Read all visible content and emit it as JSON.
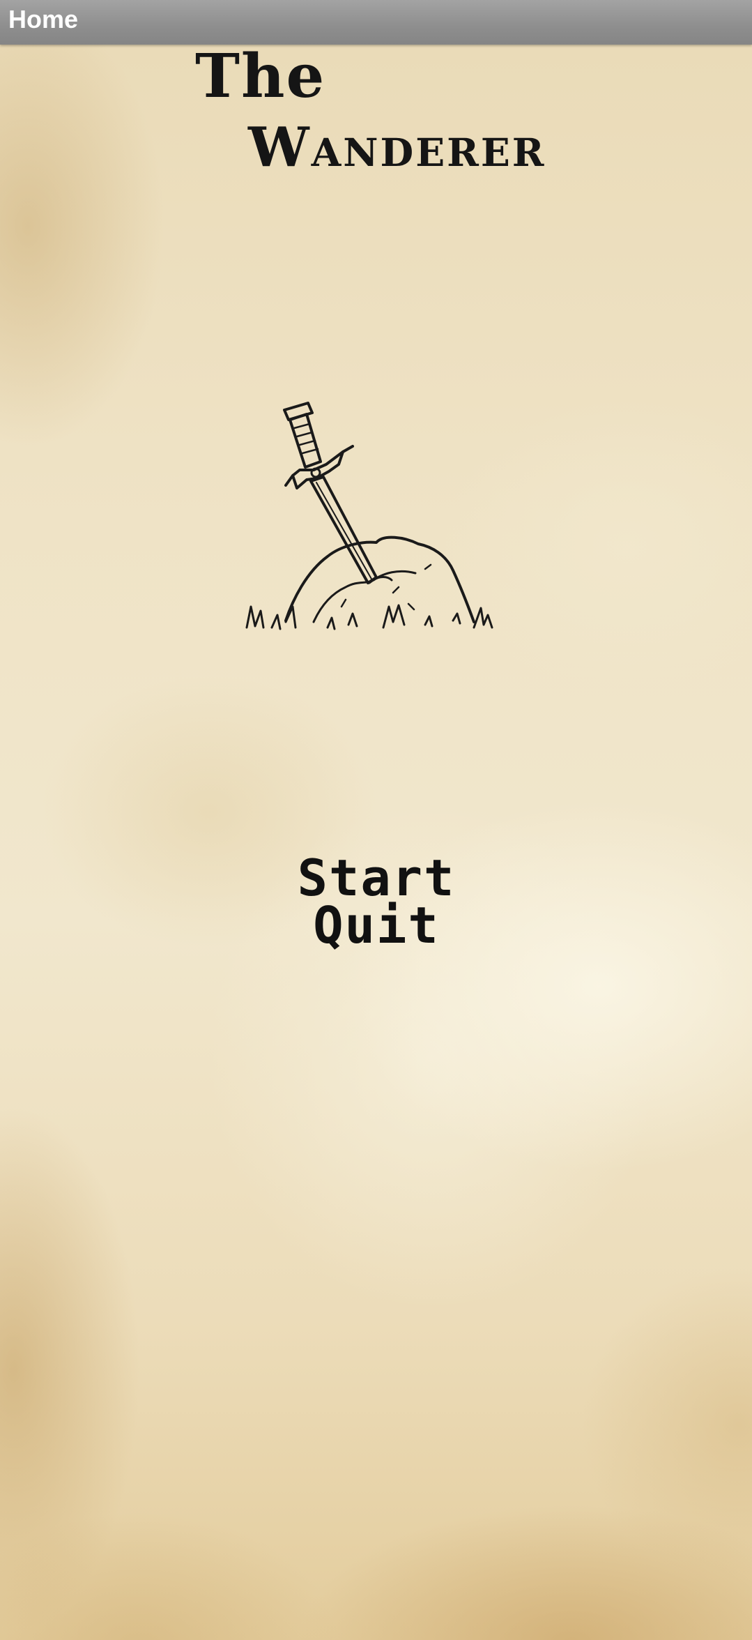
{
  "app_bar": {
    "title": "Home"
  },
  "game_title": {
    "line1": "The",
    "line2": "Wanderer"
  },
  "illustration": {
    "icon": "sword-in-stone-icon"
  },
  "menu": {
    "start_label": "Start",
    "quit_label": "Quit"
  },
  "colors": {
    "app_bar": "#8e8e8e",
    "parchment": "#efe3c6",
    "ink": "#111111"
  }
}
